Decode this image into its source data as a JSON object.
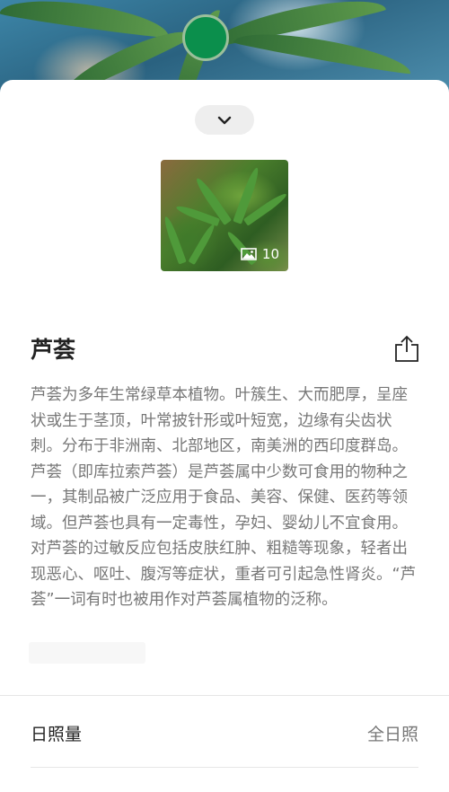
{
  "camera": {
    "shutter_color": "#0b8f4c"
  },
  "sheet": {
    "collapse_icon": "chevron-down-icon",
    "photo_count": "10",
    "title": "芦荟",
    "description": "芦荟为多年生常绿草本植物。叶簇生、大而肥厚，呈座状或生于茎顶，叶常披针形或叶短宽，边缘有尖齿状刺。分布于非洲南、北部地区，南美洲的西印度群岛。芦荟（即库拉索芦荟）是芦荟属中少数可食用的物种之一，其制品被广泛应用于食品、美容、保健、医药等领域。但芦荟也具有一定毒性，孕妇、婴幼儿不宜食用。对芦荟的过敏反应包括皮肤红肿、粗糙等现象，轻者出现恶心、呕吐、腹泻等症状，重者可引起急性肾炎。“芦荟”一词有时也被用作对芦荟属植物的泛称。",
    "attributes": [
      {
        "label": "日照量",
        "value": "全日照"
      }
    ]
  }
}
